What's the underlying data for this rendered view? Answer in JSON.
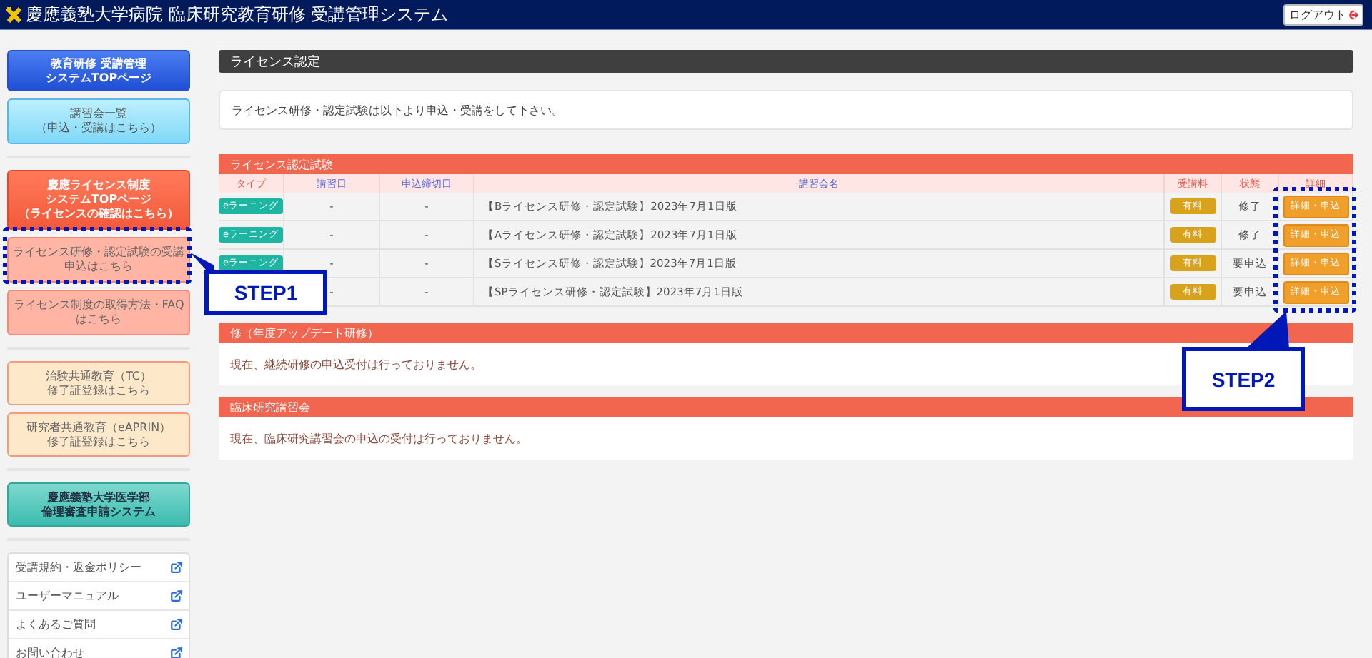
{
  "header": {
    "title": "慶應義塾大学病院 臨床研究教育研修 受講管理システム",
    "logout": "ログアウト"
  },
  "sidebar": {
    "groups": [
      [
        {
          "kind": "blue",
          "lines": [
            "教育研修 受講管理",
            "システムTOPページ"
          ]
        },
        {
          "kind": "sky",
          "lines": [
            "講習会一覧",
            "（申込・受講はこちら）"
          ]
        }
      ],
      [
        {
          "kind": "red",
          "lines": [
            "慶應ライセンス制度",
            "システムTOPページ",
            "（ライセンスの確認はこちら）"
          ]
        },
        {
          "kind": "pink",
          "lines": [
            "ライセンス研修・認定試験の受講",
            "申込はこちら"
          ]
        },
        {
          "kind": "pink",
          "lines": [
            "ライセンス制度の取得方法・FAQ",
            "はこちら"
          ]
        }
      ],
      [
        {
          "kind": "cream",
          "lines": [
            "治験共通教育（TC）",
            "修了証登録はこちら"
          ]
        },
        {
          "kind": "cream",
          "lines": [
            "研究者共通教育（eAPRIN）",
            "修了証登録はこちら"
          ]
        }
      ],
      [
        {
          "kind": "teal",
          "lines": [
            "慶應義塾大学医学部",
            "倫理審査申請システム"
          ]
        }
      ]
    ],
    "links": [
      "受講規約・返金ポリシー",
      "ユーザーマニュアル",
      "よくあるご質問",
      "お問い合わせ"
    ]
  },
  "page_title": "ライセンス認定",
  "notice": "ライセンス研修・認定試験は以下より申込・受講をして下さい。",
  "sections": [
    {
      "title": "ライセンス認定試験",
      "table": {
        "columns": [
          {
            "label": "タイプ",
            "color": "#e5584a"
          },
          {
            "label": "講習日",
            "color": "#5b6fd8"
          },
          {
            "label": "申込締切日",
            "color": "#5b6fd8"
          },
          {
            "label": "講習会名",
            "color": "#5b6fd8"
          },
          {
            "label": "受講料",
            "color": "#e5584a"
          },
          {
            "label": "状態",
            "color": "#e5584a"
          },
          {
            "label": "詳細",
            "color": "#e5584a"
          }
        ],
        "rows": [
          {
            "type": "eラーニング",
            "date": "-",
            "deadline": "-",
            "name": "【Bライセンス研修・認定試験】2023年7月1日版",
            "fee": "有料",
            "status": "修了",
            "action": "詳細・申込"
          },
          {
            "type": "eラーニング",
            "date": "-",
            "deadline": "-",
            "name": "【Aライセンス研修・認定試験】2023年7月1日版",
            "fee": "有料",
            "status": "修了",
            "action": "詳細・申込"
          },
          {
            "type": "eラーニング",
            "date": "-",
            "deadline": "-",
            "name": "【Sライセンス研修・認定試験】2023年7月1日版",
            "fee": "有料",
            "status": "要申込",
            "action": "詳細・申込"
          },
          {
            "date": "-",
            "deadline": "-",
            "name": "【SPライセンス研修・認定試験】2023年7月1日版",
            "fee": "有料",
            "status": "要申込",
            "action": "詳細・申込"
          }
        ]
      }
    },
    {
      "title": "修（年度アップデート研修）",
      "message": "現在、継続研修の申込受付は行っておりません。"
    },
    {
      "title": "臨床研究講習会",
      "message": "現在、臨床研究講習会の申込の受付は行っておりません。"
    }
  ],
  "callouts": [
    {
      "label": "STEP1",
      "kind": "sidebar"
    },
    {
      "label": "STEP2",
      "kind": "table"
    }
  ]
}
